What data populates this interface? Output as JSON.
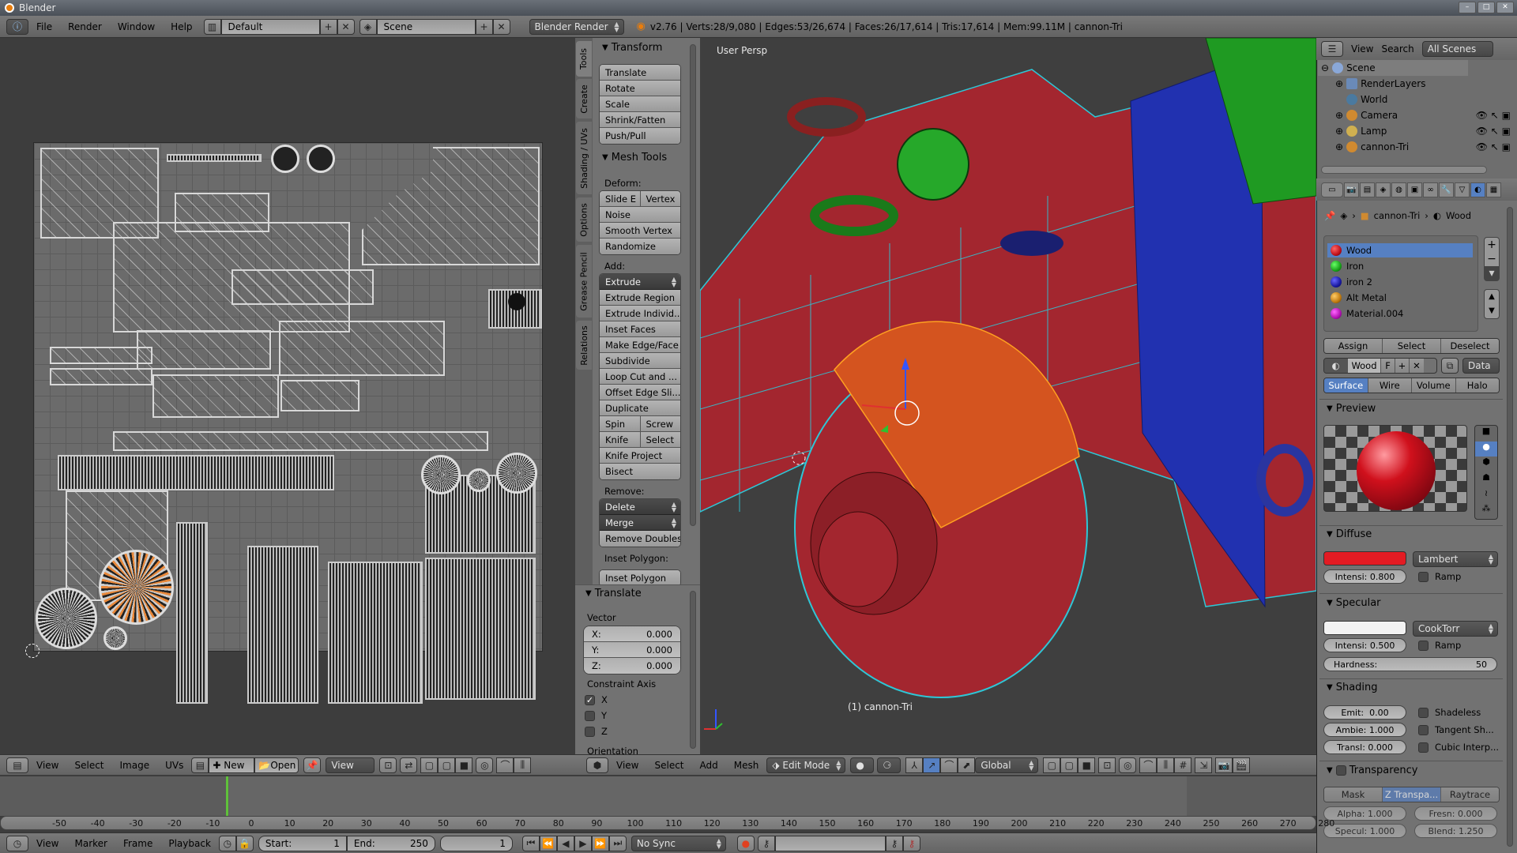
{
  "window": {
    "title": "Blender"
  },
  "info_header": {
    "menus": [
      "File",
      "Render",
      "Window",
      "Help"
    ],
    "layout": "Default",
    "scene": "Scene",
    "render_engine": "Blender Render",
    "stats": "v2.76 | Verts:28/9,080 | Edges:53/26,674 | Faces:26/17,614 | Tris:17,614 | Mem:99.11M | cannon-Tri"
  },
  "uv_editor": {
    "header_menus": [
      "View",
      "Select",
      "Image",
      "UVs"
    ],
    "new_label": "New",
    "open_label": "Open",
    "view_label": "View"
  },
  "tool_shelf": {
    "tabs": [
      "Tools",
      "Create",
      "Shading / UVs",
      "Options",
      "Grease Pencil",
      "Relations"
    ],
    "transform": {
      "title": "Transform",
      "buttons": [
        "Translate",
        "Rotate",
        "Scale",
        "Shrink/Fatten",
        "Push/Pull"
      ]
    },
    "mesh_tools": {
      "title": "Mesh Tools",
      "deform_label": "Deform:",
      "deform_row": [
        "Slide E",
        "Vertex"
      ],
      "deform_buttons": [
        "Noise",
        "Smooth Vertex",
        "Randomize"
      ],
      "add_label": "Add:",
      "extrude_dropdown": "Extrude",
      "add_buttons": [
        "Extrude Region",
        "Extrude Individ...",
        "Inset Faces",
        "Make Edge/Face",
        "Subdivide",
        "Loop Cut and ...",
        "Offset Edge Sli...",
        "Duplicate"
      ],
      "row_spin": [
        "Spin",
        "Screw"
      ],
      "row_knife": [
        "Knife",
        "Select"
      ],
      "add_buttons_2": [
        "Knife Project",
        "Bisect"
      ],
      "remove_label": "Remove:",
      "delete_dropdown": "Delete",
      "merge_dropdown": "Merge",
      "remove_doubles": "Remove Doubles",
      "inset_label": "Inset Polygon:",
      "inset_button": "Inset Polygon"
    },
    "operator": {
      "title": "Translate",
      "vector_label": "Vector",
      "x_label": "X:",
      "x_value": "0.000",
      "y_label": "Y:",
      "y_value": "0.000",
      "z_label": "Z:",
      "z_value": "0.000",
      "constraint_label": "Constraint Axis",
      "axes": [
        {
          "label": "X",
          "checked": true
        },
        {
          "label": "Y",
          "checked": false
        },
        {
          "label": "Z",
          "checked": false
        }
      ],
      "orientation_label": "Orientation"
    }
  },
  "viewport": {
    "view_label": "User Persp",
    "object_label": "(1) cannon-Tri",
    "header_menus": [
      "View",
      "Select",
      "Add",
      "Mesh"
    ],
    "mode": "Edit Mode",
    "orientation": "Global"
  },
  "outliner": {
    "menus": [
      "View",
      "Search"
    ],
    "filter": "All Scenes",
    "items": [
      {
        "label": "Scene",
        "icon": "scene-icon"
      },
      {
        "label": "RenderLayers",
        "icon": "render-layers-icon"
      },
      {
        "label": "World",
        "icon": "world-icon"
      },
      {
        "label": "Camera",
        "icon": "camera-icon"
      },
      {
        "label": "Lamp",
        "icon": "lamp-icon"
      },
      {
        "label": "cannon-Tri",
        "icon": "mesh-icon"
      }
    ]
  },
  "properties": {
    "breadcrumb": [
      "cannon-Tri",
      "Wood"
    ],
    "materials": [
      {
        "name": "Wood",
        "color": "#c0101a",
        "selected": true
      },
      {
        "name": "Iron",
        "color": "#1aa01a",
        "selected": false
      },
      {
        "name": "iron 2",
        "color": "#1a1aa0",
        "selected": false
      },
      {
        "name": "Alt Metal",
        "color": "#c07a10",
        "selected": false
      },
      {
        "name": "Material.004",
        "color": "#b010b0",
        "selected": false
      }
    ],
    "assign": "Assign",
    "select": "Select",
    "deselect": "Deselect",
    "material_name": "Wood",
    "fake_user": "F",
    "link": "Data",
    "type_tabs": [
      "Surface",
      "Wire",
      "Volume",
      "Halo"
    ],
    "active_type": "Surface",
    "preview_title": "Preview",
    "diffuse": {
      "title": "Diffuse",
      "color": "#e31b23",
      "shader": "Lambert",
      "intensity_label": "Intensi:",
      "intensity": "0.800",
      "ramp": "Ramp"
    },
    "specular": {
      "title": "Specular",
      "color": "#f2f2f2",
      "shader": "CookTorr",
      "intensity_label": "Intensi:",
      "intensity": "0.500",
      "ramp": "Ramp",
      "hardness_label": "Hardness:",
      "hardness": "50"
    },
    "shading": {
      "title": "Shading",
      "emit_label": "Emit:",
      "emit": "0.00",
      "ambient_label": "Ambie:",
      "ambient": "1.000",
      "transl_label": "Transl:",
      "transl": "0.000",
      "shadeless": "Shadeless",
      "tangent": "Tangent Sh...",
      "cubic": "Cubic Interp..."
    },
    "transparency": {
      "title": "Transparency",
      "modes": [
        "Mask",
        "Z Transpa...",
        "Raytrace"
      ],
      "active_mode": "Z Transpa...",
      "alpha_label": "Alpha:",
      "alpha": "1.000",
      "fresnel_label": "Fresn:",
      "fresnel": "0.000",
      "specular_label": "Specul:",
      "specular": "1.000",
      "blend_label": "Blend:",
      "blend": "1.250"
    }
  },
  "timeline": {
    "menus": [
      "View",
      "Marker",
      "Frame",
      "Playback"
    ],
    "start_label": "Start:",
    "start": "1",
    "end_label": "End:",
    "end": "250",
    "current": "1",
    "sync": "No Sync",
    "ruler": [
      "-50",
      "-40",
      "-30",
      "-20",
      "-10",
      "0",
      "10",
      "20",
      "30",
      "40",
      "50",
      "60",
      "70",
      "80",
      "90",
      "100",
      "110",
      "120",
      "130",
      "140",
      "150",
      "160",
      "170",
      "180",
      "190",
      "200",
      "210",
      "220",
      "230",
      "240",
      "250",
      "260",
      "270",
      "280"
    ]
  }
}
